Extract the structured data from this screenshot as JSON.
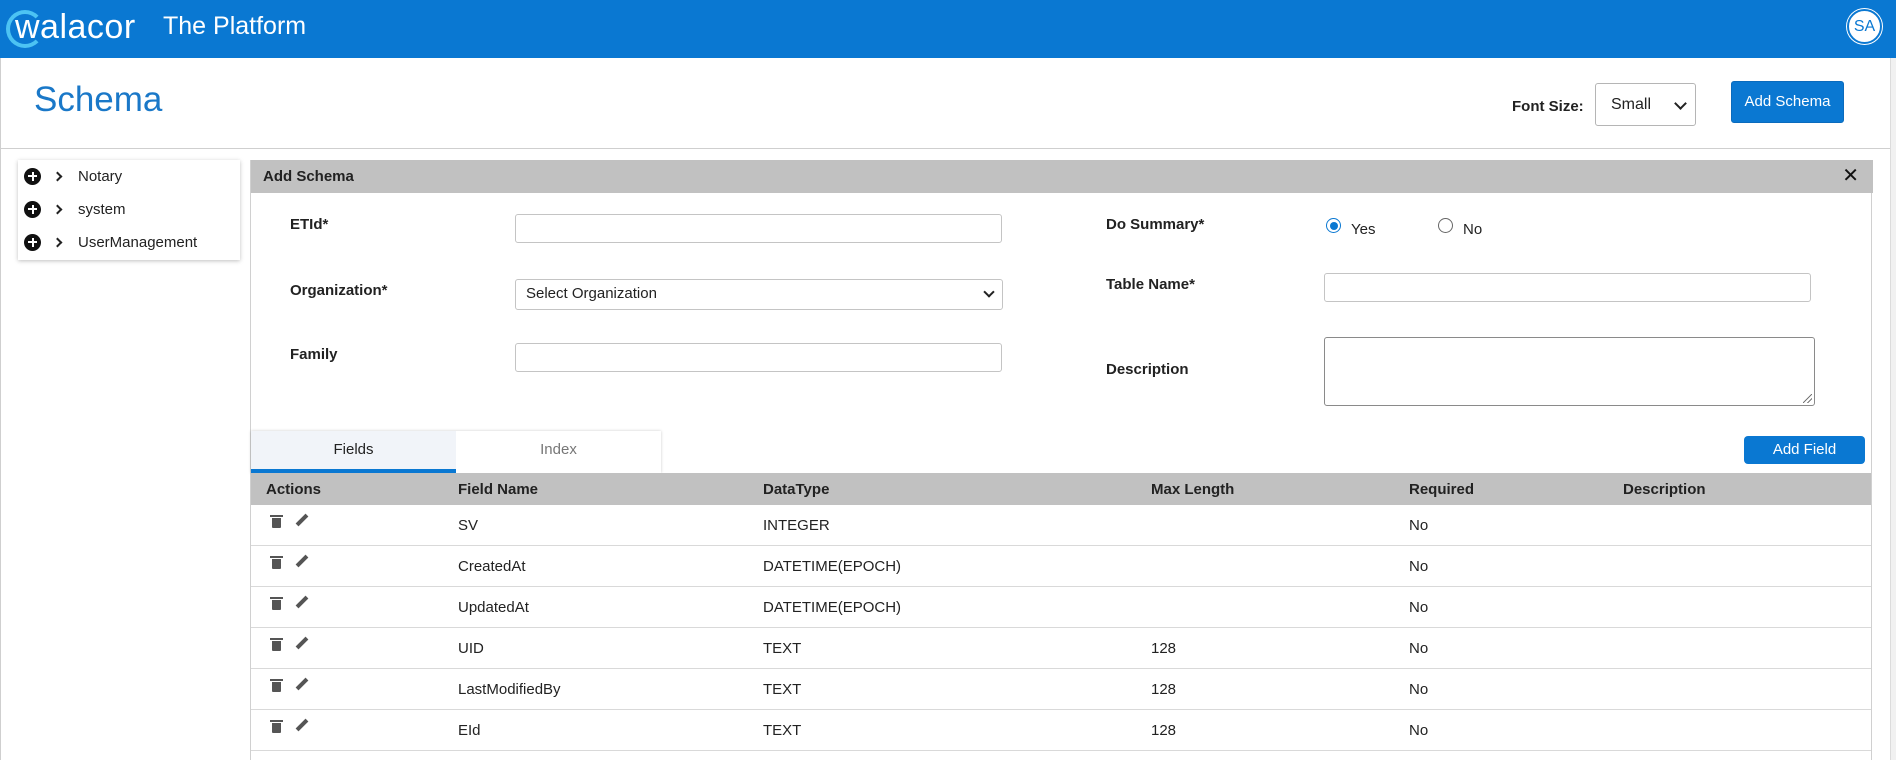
{
  "topbar": {
    "brand": "walacor",
    "title": "The Platform",
    "avatar": "SA"
  },
  "page": {
    "title": "Schema",
    "font_size_label": "Font Size:",
    "font_size_value": "Small",
    "add_schema_label": "Add Schema"
  },
  "tree": [
    {
      "label": "Notary"
    },
    {
      "label": "system"
    },
    {
      "label": "UserManagement"
    }
  ],
  "panel": {
    "title": "Add Schema",
    "close_glyph": "✕",
    "etid_label": "ETId*",
    "etid_value": "",
    "organization_label": "Organization*",
    "organization_value": "Select Organization",
    "family_label": "Family",
    "family_value": "",
    "do_summary_label": "Do Summary*",
    "do_summary_options": [
      "Yes",
      "No"
    ],
    "do_summary_selected": "Yes",
    "table_name_label": "Table Name*",
    "table_name_value": "",
    "description_label": "Description",
    "description_value": ""
  },
  "tabs": [
    {
      "label": "Fields",
      "active": true
    },
    {
      "label": "Index",
      "active": false
    }
  ],
  "add_field_label": "Add Field",
  "table": {
    "columns": [
      "Actions",
      "Field Name",
      "DataType",
      "Max Length",
      "Required",
      "Description"
    ],
    "rows": [
      {
        "field_name": "SV",
        "datatype": "INTEGER",
        "max_length": "",
        "required": "No",
        "description": ""
      },
      {
        "field_name": "CreatedAt",
        "datatype": "DATETIME(EPOCH)",
        "max_length": "",
        "required": "No",
        "description": ""
      },
      {
        "field_name": "UpdatedAt",
        "datatype": "DATETIME(EPOCH)",
        "max_length": "",
        "required": "No",
        "description": ""
      },
      {
        "field_name": "UID",
        "datatype": "TEXT",
        "max_length": "128",
        "required": "No",
        "description": ""
      },
      {
        "field_name": "LastModifiedBy",
        "datatype": "TEXT",
        "max_length": "128",
        "required": "No",
        "description": ""
      },
      {
        "field_name": "EId",
        "datatype": "TEXT",
        "max_length": "128",
        "required": "No",
        "description": ""
      }
    ]
  },
  "icons": {
    "tree_expand": "plus-circle-icon",
    "tree_caret": "chevron-right-icon",
    "row_delete": "trash-icon",
    "row_edit": "pencil-icon",
    "close": "close-icon",
    "select": "chevron-down-icon"
  },
  "colors": {
    "brand_blue": "#0a78d2",
    "header_gray": "#c1c1c1",
    "title_blue": "#1a78c8"
  }
}
